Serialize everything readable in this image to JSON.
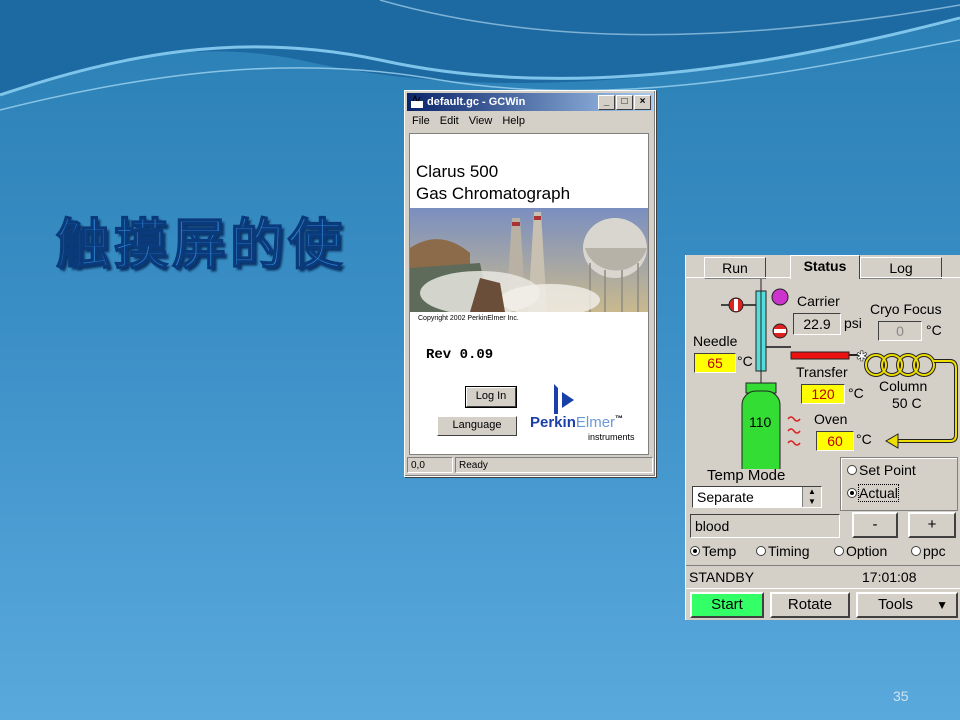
{
  "slide": {
    "title": "触摸屏的使",
    "page_number": "35"
  },
  "gcwin": {
    "title": "default.gc - GCWin",
    "menu": [
      "File",
      "Edit",
      "View",
      "Help"
    ],
    "product_line1": "Clarus 500",
    "product_line2": "Gas Chromatograph",
    "copyright": "Copyright 2002 PerkinElmer Inc.",
    "revision": "Rev 0.09",
    "login_label": "Log In",
    "language_label": "Language",
    "logo_name": "PerkinElmer",
    "logo_perkin": "Perkin",
    "logo_elmer": "Elmer",
    "logo_tm": "™",
    "logo_sub": "instruments",
    "status_coords": "0,0",
    "status_text": "Ready"
  },
  "panel": {
    "tabs": [
      "Run",
      "Status",
      "Log"
    ],
    "active_tab": "Status",
    "carrier_label": "Carrier",
    "carrier_value": "22.9",
    "carrier_unit": "psi",
    "cryo_label": "Cryo Focus",
    "cryo_value": "0",
    "cryo_unit": "°C",
    "needle_label": "Needle",
    "needle_value": "65",
    "needle_unit": "°C",
    "transfer_label": "Transfer",
    "transfer_value": "120",
    "transfer_unit": "°C",
    "column_label": "Column",
    "column_value": "50 C",
    "oven_label": "Oven",
    "oven_value": "60",
    "oven_unit": "°C",
    "vial_value": "110",
    "temp_mode_label": "Temp Mode",
    "temp_mode_value": "Separate",
    "setpoint_label": "Set Point",
    "actual_label": "Actual",
    "method_name": "blood",
    "minus_label": "-",
    "plus_label": "+",
    "radio_temp": "Temp",
    "radio_timing": "Timing",
    "radio_option": "Option",
    "radio_ppc": "ppc",
    "status_text": "STANDBY",
    "time_text": "17:01:08",
    "start_label": "Start",
    "rotate_label": "Rotate",
    "tools_label": "Tools",
    "colors": {
      "start": "#33ff66",
      "field": "#ffff00",
      "vial": "#33dd33",
      "transfer_line": "#ee1111"
    }
  }
}
